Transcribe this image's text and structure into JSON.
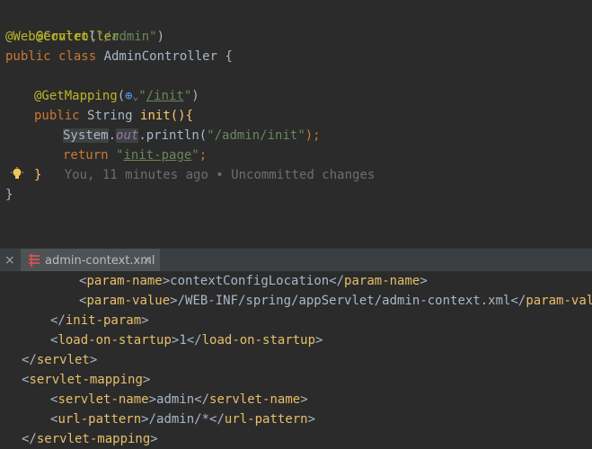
{
  "editor_top": {
    "lines": [
      {
        "ann": "@Controller"
      },
      {
        "ann": "@WebServlet",
        "paren_open": "(",
        "str": "\"/admin\"",
        "paren_close": ")"
      },
      {
        "kw": "public class ",
        "cls": "AdminController {"
      },
      {
        "ann": "@GetMapping",
        "paren_open": "(",
        "globe": "⊕",
        "chev": "⌄",
        "q1": "\"",
        "path": "/init",
        "q2": "\"",
        "paren_close": ")"
      },
      {
        "kw": "public ",
        "type": "String ",
        "mth": "init",
        "rest": "(){"
      },
      {
        "sys": "System",
        "dot": ".",
        "fld": "out",
        "rest": ".println(",
        "str": "\"/admin/init\"",
        "end": ");"
      },
      {
        "kw": "return ",
        "q1": "\"",
        "str": "init-page",
        "q2": "\"",
        "end": ";"
      },
      {
        "brace": "}",
        "blame": "You, 11 minutes ago • Uncommitted changes"
      },
      {
        "brace": "}"
      }
    ]
  },
  "tabbar": {
    "close_left": "×",
    "tab_label": "admin-context.xml",
    "tab_close": "×"
  },
  "editor_bottom": {
    "lines": [
      {
        "open": "<",
        "tag": "param-name",
        "close": ">",
        "text": "contextConfigLocation",
        "open2": "</",
        "tag2": "param-name",
        "close2": ">"
      },
      {
        "open": "<",
        "tag": "param-value",
        "close": ">",
        "text": "/WEB-INF/spring/appServlet/admin-context.xml",
        "open2": "</",
        "tag2": "param-value",
        "close2": ">"
      },
      {
        "open": "</",
        "tag": "init-param",
        "close": ">"
      },
      {
        "open": "<",
        "tag": "load-on-startup",
        "close": ">",
        "text": "1",
        "open2": "</",
        "tag2": "load-on-startup",
        "close2": ">"
      },
      {
        "open": "</",
        "tag": "servlet",
        "close": ">"
      },
      {
        "open": "<",
        "tag": "servlet-mapping",
        "close": ">"
      },
      {
        "open": "<",
        "tag": "servlet-name",
        "close": ">",
        "text": "admin",
        "open2": "</",
        "tag2": "servlet-name",
        "close2": ">"
      },
      {
        "open": "<",
        "tag": "url-pattern",
        "close": ">",
        "text": "/admin/*",
        "open2": "</",
        "tag2": "url-pattern",
        "close2": ">"
      },
      {
        "open": "</",
        "tag": "servlet-mapping",
        "close": ">"
      }
    ]
  }
}
